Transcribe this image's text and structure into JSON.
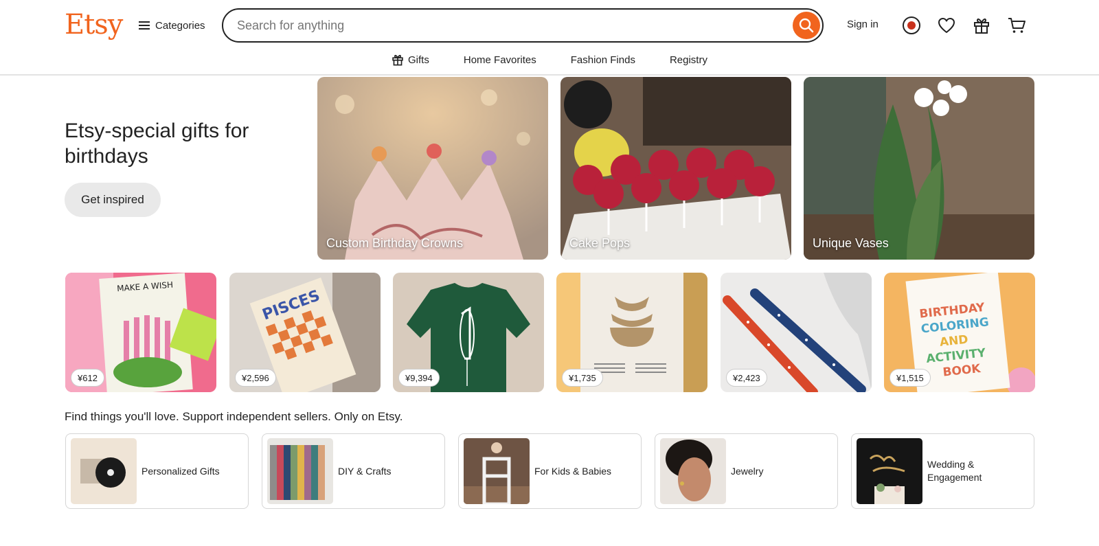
{
  "header": {
    "logo": "Etsy",
    "categories_label": "Categories",
    "search_placeholder": "Search for anything",
    "sign_in": "Sign in"
  },
  "subnav": [
    {
      "label": "Gifts",
      "icon": "gift-icon"
    },
    {
      "label": "Home Favorites"
    },
    {
      "label": "Fashion Finds"
    },
    {
      "label": "Registry"
    }
  ],
  "hero": {
    "title": "Etsy-special gifts for birthdays",
    "button": "Get inspired",
    "tiles": [
      {
        "label": "Custom Birthday Crowns"
      },
      {
        "label": "Cake Pops"
      },
      {
        "label": "Unique Vases"
      }
    ]
  },
  "products": [
    {
      "price": "¥612"
    },
    {
      "price": "¥2,596"
    },
    {
      "price": "¥9,394"
    },
    {
      "price": "¥1,735"
    },
    {
      "price": "¥2,423"
    },
    {
      "price": "¥1,515"
    }
  ],
  "tagline": "Find things you'll love. Support independent sellers. Only on Etsy.",
  "categories": [
    {
      "label": "Personalized Gifts"
    },
    {
      "label": "DIY & Crafts"
    },
    {
      "label": "For Kids & Babies"
    },
    {
      "label": "Jewelry"
    },
    {
      "label": "Wedding & Engagement"
    }
  ],
  "colors": {
    "brand": "#f1641e",
    "text": "#222222",
    "button_bg": "#e9e9e9"
  }
}
